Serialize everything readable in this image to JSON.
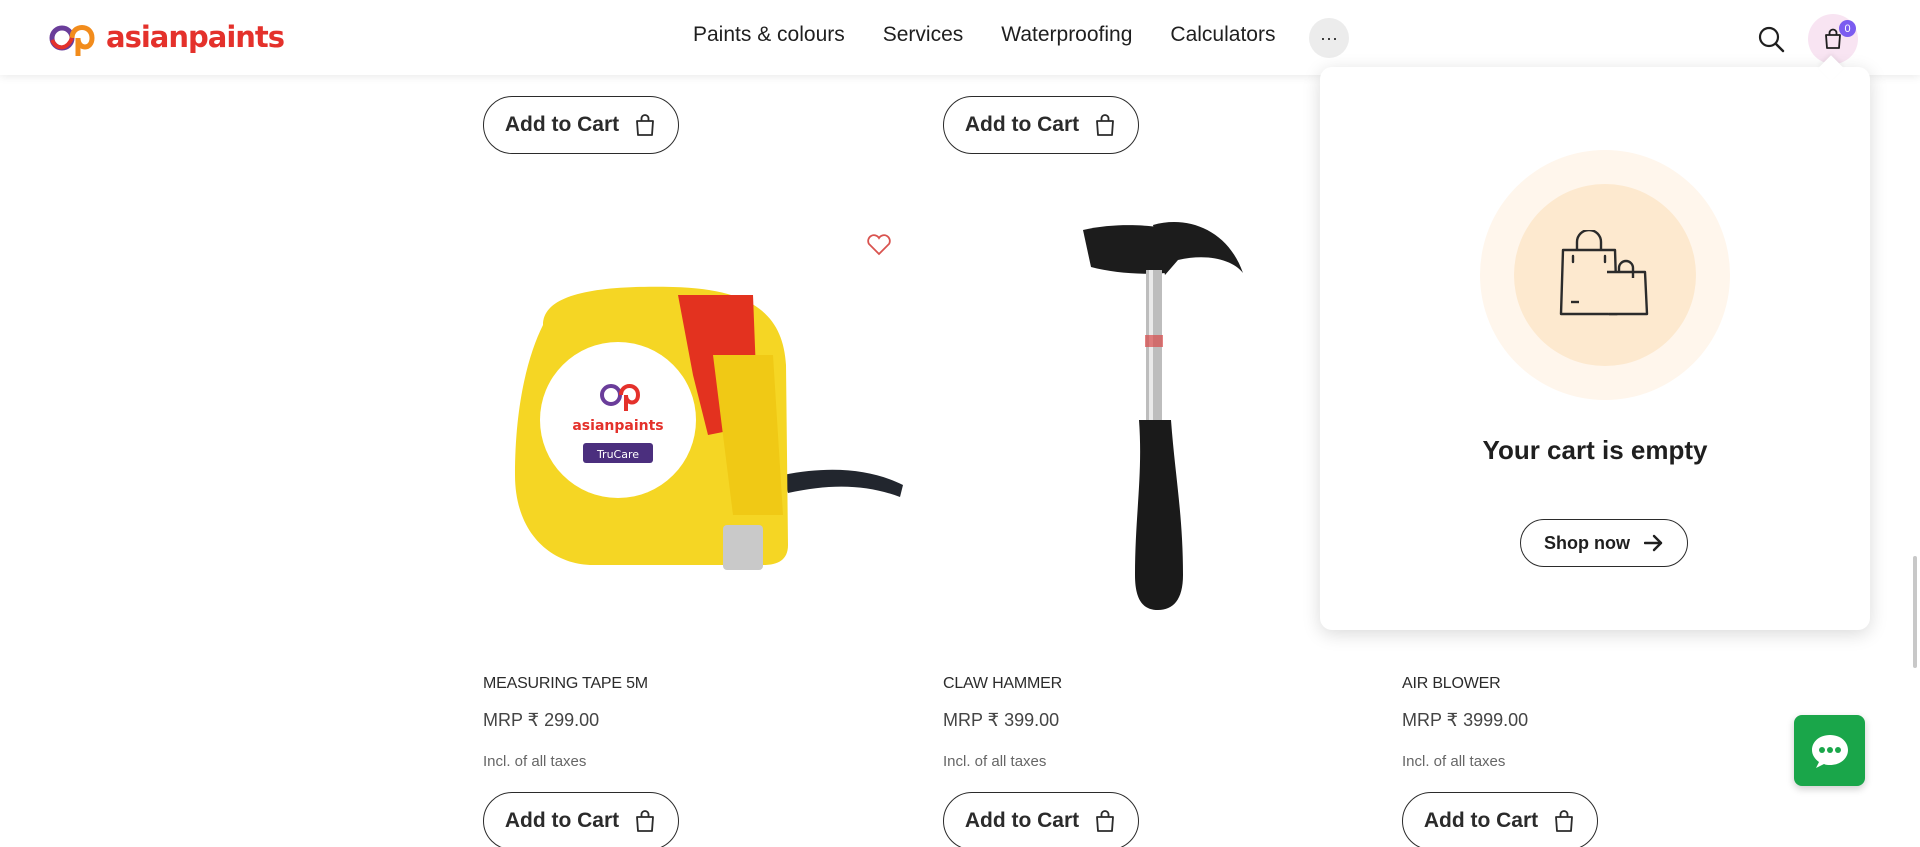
{
  "brand": {
    "name": "asianpaints"
  },
  "nav": {
    "items": [
      "Paints & colours",
      "Services",
      "Waterproofing",
      "Calculators"
    ],
    "more_label": "···"
  },
  "header": {
    "cart_count": "0"
  },
  "top_row": {
    "add_to_cart_label": "Add to Cart"
  },
  "products": [
    {
      "name": "MEASURING TAPE 5M",
      "price": "MRP ₹ 299.00",
      "tax": "Incl. of all taxes",
      "add_to_cart_label": "Add to Cart"
    },
    {
      "name": "CLAW HAMMER",
      "price": "MRP ₹ 399.00",
      "tax": "Incl. of all taxes",
      "add_to_cart_label": "Add to Cart"
    },
    {
      "name": "AIR BLOWER",
      "price": "MRP ₹ 3999.00",
      "tax": "Incl. of all taxes",
      "add_to_cart_label": "Add to Cart"
    }
  ],
  "tape_logo": {
    "brand": "asianpaints",
    "sub": "TruCare"
  },
  "cart_popover": {
    "title": "Your cart is empty",
    "shop_label": "Shop now"
  },
  "colors": {
    "brand_red": "#e4312b",
    "accent_purple": "#7b5cf0",
    "chat_green": "#1aa64a"
  }
}
